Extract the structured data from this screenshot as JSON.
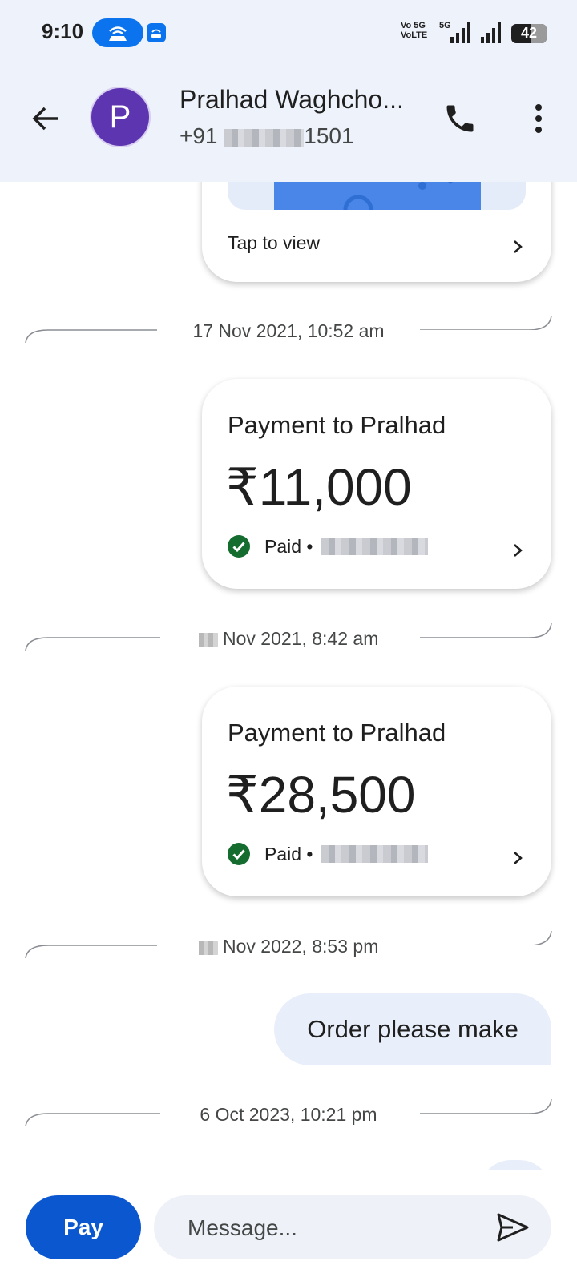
{
  "status_bar": {
    "time": "9:10",
    "network_line1": "Vo 5G",
    "network_line2": "VoLTE",
    "network_5g": "5G",
    "battery": "42"
  },
  "header": {
    "contact_initial": "P",
    "contact_name": "Pralhad Waghcho...",
    "phone_prefix": "+91",
    "phone_suffix": "1501"
  },
  "chat": {
    "first_card": {
      "tap_label": "Tap to view"
    },
    "entries": [
      {
        "date": "17 Nov 2021, 10:52 am",
        "title": "Payment to Pralhad",
        "amount": "₹11,000",
        "status": "Paid •"
      },
      {
        "date": "Nov 2021, 8:42 am",
        "title": "Payment to Pralhad",
        "amount": "₹28,500",
        "status": "Paid •"
      }
    ],
    "date_3": "Nov 2022, 8:53 pm",
    "message": "Order please make",
    "date_4": "6 Oct 2023, 10:21 pm"
  },
  "bottom": {
    "pay_label": "Pay",
    "message_placeholder": "Message..."
  },
  "colors": {
    "primary": "#0b57d0",
    "avatar": "#5e35b1",
    "success": "#146c2e",
    "header_bg": "#eef2fa"
  }
}
